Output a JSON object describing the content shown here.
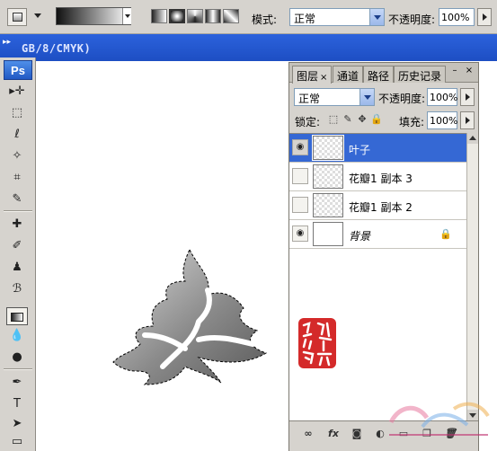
{
  "options_bar": {
    "mode_label": "模式:",
    "mode_value": "正常",
    "opacity_label": "不透明度:",
    "opacity_value": "100%"
  },
  "document": {
    "title": "GB/8/CMYK)"
  },
  "toolbox": {
    "logo": "Ps"
  },
  "layers_panel": {
    "tabs": [
      {
        "label": "图层",
        "active": true
      },
      {
        "label": "通道",
        "active": false
      },
      {
        "label": "路径",
        "active": false
      },
      {
        "label": "历史记录",
        "active": false
      }
    ],
    "blend_mode": "正常",
    "opacity_label": "不透明度:",
    "opacity_value": "100%",
    "lock_label": "锁定:",
    "fill_label": "填充:",
    "fill_value": "100%",
    "layers": [
      {
        "name": "叶子",
        "visible": true,
        "selected": true
      },
      {
        "name": "花瓣1 副本 3",
        "visible": false,
        "selected": false
      },
      {
        "name": "花瓣1 副本 2",
        "visible": false,
        "selected": false
      },
      {
        "name": "背景",
        "visible": true,
        "selected": false,
        "locked": true
      }
    ],
    "footer_icons": [
      "link-icon",
      "fx-icon",
      "mask-icon",
      "adjustment-icon",
      "folder-icon",
      "new-layer-icon",
      "trash-icon"
    ]
  },
  "colors": {
    "title_bar": "#1d4ec3",
    "selected_layer": "#3568d4",
    "panel_bg": "#d6d3ce",
    "seal_red": "#d42a2a"
  }
}
